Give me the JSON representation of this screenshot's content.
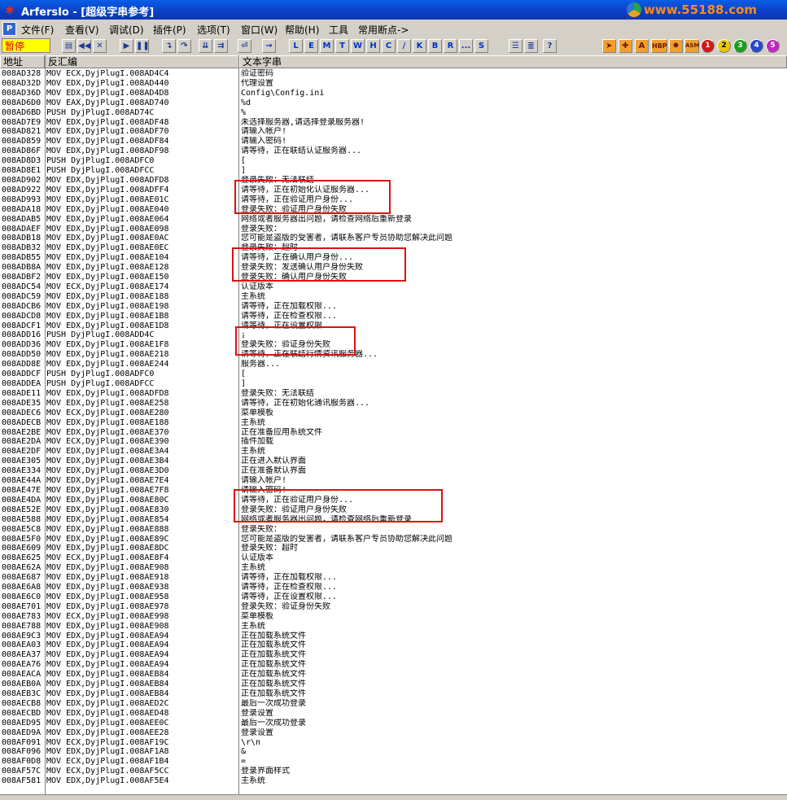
{
  "window": {
    "title": "ArfersIo - [超级字串参考]",
    "watermark": "www.55188.com"
  },
  "menu": [
    {
      "label": "文件(F)"
    },
    {
      "label": "查看(V)"
    },
    {
      "label": "调试(D)"
    },
    {
      "label": "插件(P)"
    },
    {
      "label": "选项(T)"
    },
    {
      "label": "窗口(W)"
    },
    {
      "label": "帮助(H)"
    },
    {
      "label": "工具"
    },
    {
      "label": "常用断点->"
    }
  ],
  "toolbar": {
    "status": "暂停",
    "letter_buttons": [
      "L",
      "E",
      "M",
      "T",
      "W",
      "H",
      "C",
      "/",
      "K",
      "B",
      "R",
      "...",
      "S"
    ],
    "right_buttons": [
      "HBP",
      "ASM",
      "1",
      "2",
      "3",
      "4",
      "5"
    ]
  },
  "columns": {
    "address": "地址",
    "disasm": "反汇编",
    "text": "文本字串"
  },
  "rows": [
    [
      "008AD328",
      "MOV ECX,DyjPlugI.008AD4C4",
      "验证密码"
    ],
    [
      "008AD32D",
      "MOV EDX,DyjPlugI.008AD440",
      "代理设置"
    ],
    [
      "008AD36D",
      "MOV EDX,DyjPlugI.008AD4D8",
      "Config\\Config.ini"
    ],
    [
      "008AD6D0",
      "MOV EAX,DyjPlugI.008AD740",
      "%d"
    ],
    [
      "008AD6BD",
      "PUSH DyjPlugI.008AD74C",
      "%"
    ],
    [
      "008AD7E9",
      "MOV EDX,DyjPlugI.008ADF48",
      "未选择服务器,请选择登录服务器!"
    ],
    [
      "008AD821",
      "MOV EDX,DyjPlugI.008ADF70",
      "请输入帐户!"
    ],
    [
      "008AD859",
      "MOV EDX,DyjPlugI.008ADF84",
      "请输入密码!"
    ],
    [
      "008AD86F",
      "MOV EDX,DyjPlugI.008ADF98",
      "请等待，正在联结认证服务器..."
    ],
    [
      "008AD8D3",
      "PUSH DyjPlugI.008ADFC0",
      "["
    ],
    [
      "008AD8E1",
      "PUSH DyjPlugI.008ADFCC",
      "]"
    ],
    [
      "008AD902",
      "MOV EDX,DyjPlugI.008ADFD8",
      "登录失败：无法联结"
    ],
    [
      "008AD922",
      "MOV EDX,DyjPlugI.008ADFF4",
      "请等待，正在初始化认证服务器..."
    ],
    [
      "008AD993",
      "MOV EDX,DyjPlugI.008AE01C",
      "请等待，正在验证用户身份..."
    ],
    [
      "008ADA18",
      "MOV EDX,DyjPlugI.008AE040",
      "登录失败：验证用户身份失败"
    ],
    [
      "008ADAB5",
      "MOV EDX,DyjPlugI.008AE064",
      "网络或者服务器出问题，请检查网络后重新登录"
    ],
    [
      "008ADAEF",
      "MOV EDX,DyjPlugI.008AE098",
      "登录失败："
    ],
    [
      "008ADB18",
      "MOV EDX,DyjPlugI.008AE0AC",
      "您可能是盗版的受害者，请联系客户专员协助您解决此问题"
    ],
    [
      "008ADB32",
      "MOV EDX,DyjPlugI.008AE0EC",
      "登录失败：超时"
    ],
    [
      "008ADB55",
      "MOV EDX,DyjPlugI.008AE104",
      "请等待，正在确认用户身份..."
    ],
    [
      "008ADB8A",
      "MOV EDX,DyjPlugI.008AE128",
      "登录失败：发送确认用户身份失败"
    ],
    [
      "008ADBF2",
      "MOV EDX,DyjPlugI.008AE150",
      "登录失败：确认用户身份失败"
    ],
    [
      "008ADC54",
      "MOV ECX,DyjPlugI.008AE174",
      "认证版本"
    ],
    [
      "008ADC59",
      "MOV EDX,DyjPlugI.008AE188",
      "主系统"
    ],
    [
      "008ADCB6",
      "MOV EDX,DyjPlugI.008AE198",
      "请等待，正在加载权限..."
    ],
    [
      "008ADCD8",
      "MOV EDX,DyjPlugI.008AE1B8",
      "请等待，正在检查权限..."
    ],
    [
      "008ADCF1",
      "MOV EDX,DyjPlugI.008AE1D8",
      "请等待，正在设置权限..."
    ],
    [
      "008ADD16",
      "PUSH DyjPlugI.008ADD4C",
      "¡"
    ],
    [
      "008ADD36",
      "MOV EDX,DyjPlugI.008AE1F8",
      "登录失败：验证身份失败"
    ],
    [
      "008ADD50",
      "MOV EDX,DyjPlugI.008AE218",
      "请等待，正在联结行情资讯服务器..."
    ],
    [
      "008ADD8E",
      "MOV EDX,DyjPlugI.008AE244",
      "服务器..."
    ],
    [
      "008ADDCF",
      "PUSH DyjPlugI.008ADFC0",
      "["
    ],
    [
      "008ADDEA",
      "PUSH DyjPlugI.008ADFCC",
      "]"
    ],
    [
      "008ADE11",
      "MOV EDX,DyjPlugI.008ADFD8",
      "登录失败：无法联结"
    ],
    [
      "008ADE35",
      "MOV EDX,DyjPlugI.008AE258",
      "请等待，正在初始化通讯服务器..."
    ],
    [
      "008ADEC6",
      "MOV ECX,DyjPlugI.008AE280",
      "菜单模板"
    ],
    [
      "008ADECB",
      "MOV EDX,DyjPlugI.008AE188",
      "主系统"
    ],
    [
      "008AE2BE",
      "MOV EDX,DyjPlugI.008AE370",
      "正在准备应用系统文件"
    ],
    [
      "008AE2DA",
      "MOV ECX,DyjPlugI.008AE390",
      "插件加载"
    ],
    [
      "008AE2DF",
      "MOV EDX,DyjPlugI.008AE3A4",
      "主系统"
    ],
    [
      "008AE305",
      "MOV EDX,DyjPlugI.008AE3B4",
      "正在进入默认界面"
    ],
    [
      "008AE334",
      "MOV EDX,DyjPlugI.008AE3D0",
      "正在准备默认界面"
    ],
    [
      "008AE44A",
      "MOV EDX,DyjPlugI.008AE7E4",
      "请输入帐户!"
    ],
    [
      "008AE47E",
      "MOV EDX,DyjPlugI.008AE7F8",
      "请输入密码!"
    ],
    [
      "008AE4DA",
      "MOV EDX,DyjPlugI.008AE80C",
      "请等待，正在验证用户身份..."
    ],
    [
      "008AE52E",
      "MOV EDX,DyjPlugI.008AE830",
      "登录失败：验证用户身份失败"
    ],
    [
      "008AE588",
      "MOV EDX,DyjPlugI.008AE854",
      "网络或者服务器出问题，请检查网络后重新登录"
    ],
    [
      "008AE5C8",
      "MOV EDX,DyjPlugI.008AE888",
      "登录失败："
    ],
    [
      "008AE5F0",
      "MOV EDX,DyjPlugI.008AE89C",
      "您可能是盗版的受害者，请联系客户专员协助您解决此问题"
    ],
    [
      "008AE609",
      "MOV EDX,DyjPlugI.008AE8DC",
      "登录失败：超时"
    ],
    [
      "008AE625",
      "MOV ECX,DyjPlugI.008AE8F4",
      "认证版本"
    ],
    [
      "008AE62A",
      "MOV EDX,DyjPlugI.008AE908",
      "主系统"
    ],
    [
      "008AE687",
      "MOV EDX,DyjPlugI.008AE918",
      "请等待，正在加载权限..."
    ],
    [
      "008AE6A8",
      "MOV EDX,DyjPlugI.008AE938",
      "请等待，正在检查权限..."
    ],
    [
      "008AE6C0",
      "MOV EDX,DyjPlugI.008AE958",
      "请等待，正在设置权限..."
    ],
    [
      "008AE701",
      "MOV EDX,DyjPlugI.008AE978",
      "登录失败：验证身份失败"
    ],
    [
      "008AE783",
      "MOV ECX,DyjPlugI.008AE998",
      "菜单模板"
    ],
    [
      "008AE788",
      "MOV EDX,DyjPlugI.008AE908",
      "主系统"
    ],
    [
      "008AE9C3",
      "MOV EDX,DyjPlugI.008AEA94",
      "正在加载系统文件"
    ],
    [
      "008AEA03",
      "MOV EDX,DyjPlugI.008AEA94",
      "正在加载系统文件"
    ],
    [
      "008AEA37",
      "MOV EDX,DyjPlugI.008AEA94",
      "正在加载系统文件"
    ],
    [
      "008AEA76",
      "MOV EDX,DyjPlugI.008AEA94",
      "正在加载系统文件"
    ],
    [
      "008AEACA",
      "MOV EDX,DyjPlugI.008AEB84",
      "正在加载系统文件"
    ],
    [
      "008AEB0A",
      "MOV EDX,DyjPlugI.008AEB84",
      "正在加载系统文件"
    ],
    [
      "008AEB3C",
      "MOV EDX,DyjPlugI.008AEB84",
      "正在加载系统文件"
    ],
    [
      "008AECB8",
      "MOV EDX,DyjPlugI.008AED2C",
      "最后一次成功登录"
    ],
    [
      "008AECBD",
      "MOV EDX,DyjPlugI.008AED48",
      "登录设置"
    ],
    [
      "008AED95",
      "MOV EDX,DyjPlugI.008AEE0C",
      "最后一次成功登录"
    ],
    [
      "008AED9A",
      "MOV EDX,DyjPlugI.008AEE28",
      "登录设置"
    ],
    [
      "008AF091",
      "MOV ECX,DyjPlugI.008AF19C",
      "\\r\\n"
    ],
    [
      "008AF096",
      "MOV EDX,DyjPlugI.008AF1A8",
      "&"
    ],
    [
      "008AF0D8",
      "MOV ECX,DyjPlugI.008AF1B4",
      "="
    ],
    [
      "008AF57C",
      "MOV ECX,DyjPlugI.008AF5CC",
      "登录界面样式"
    ],
    [
      "008AF581",
      "MOV EDX,DyjPlugI.008AF5E4",
      "主系统"
    ]
  ]
}
